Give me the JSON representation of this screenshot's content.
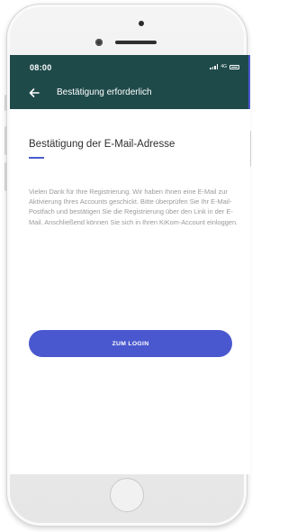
{
  "status": {
    "time": "08:00",
    "network": "4G"
  },
  "appbar": {
    "title": "Bestätigung erforderlich",
    "back_icon": "arrow-left-icon"
  },
  "content": {
    "title": "Bestätigung der E-Mail-Adresse",
    "body": "Vielen Dank für Ihre Registrierung. Wir haben Ihnen eine E-Mail zur Aktivierung Ihres Accounts geschickt. Bitte überprüfen Sie Ihr E-Mail-Postfach und bestätigen Sie die Registrierung über den Link in der E-Mail. Anschließend können Sie sich in Ihren KiKom-Account einloggen."
  },
  "actions": {
    "login_label": "ZUM LOGIN"
  },
  "colors": {
    "appbar": "#1f4a4a",
    "accent": "#4a58cf",
    "title_text": "#2f2f2f",
    "body_text": "#9a9a9a"
  }
}
